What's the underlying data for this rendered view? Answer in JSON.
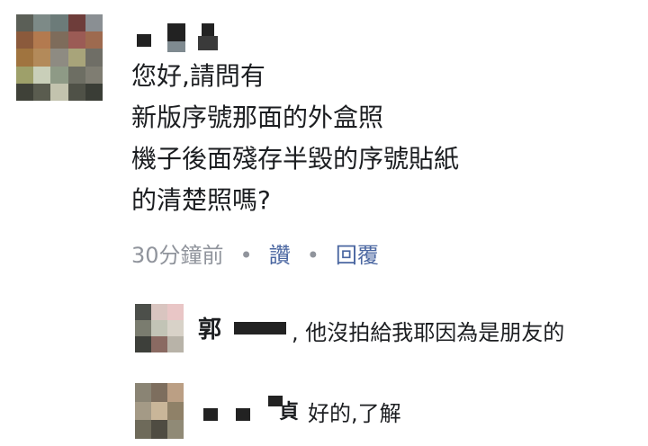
{
  "colors": {
    "text": "#1c1e21",
    "meta_gray": "#90949c",
    "link_blue": "#4b67a1",
    "background": "#ffffff"
  },
  "comment": {
    "lines": [
      "您好,請問有",
      "新版序號那面的外盒照",
      "機子後面殘存半毀的序號貼紙",
      "的清楚照嗎?"
    ],
    "time": "30分鐘前",
    "separator": "•",
    "like_label": "讚",
    "reply_label": "回覆"
  },
  "replies": [
    {
      "name_visible": "郭",
      "text": ", 他沒拍給我耶因為是朋友的"
    },
    {
      "name_visible": "貞",
      "text": "好的,了解"
    }
  ]
}
